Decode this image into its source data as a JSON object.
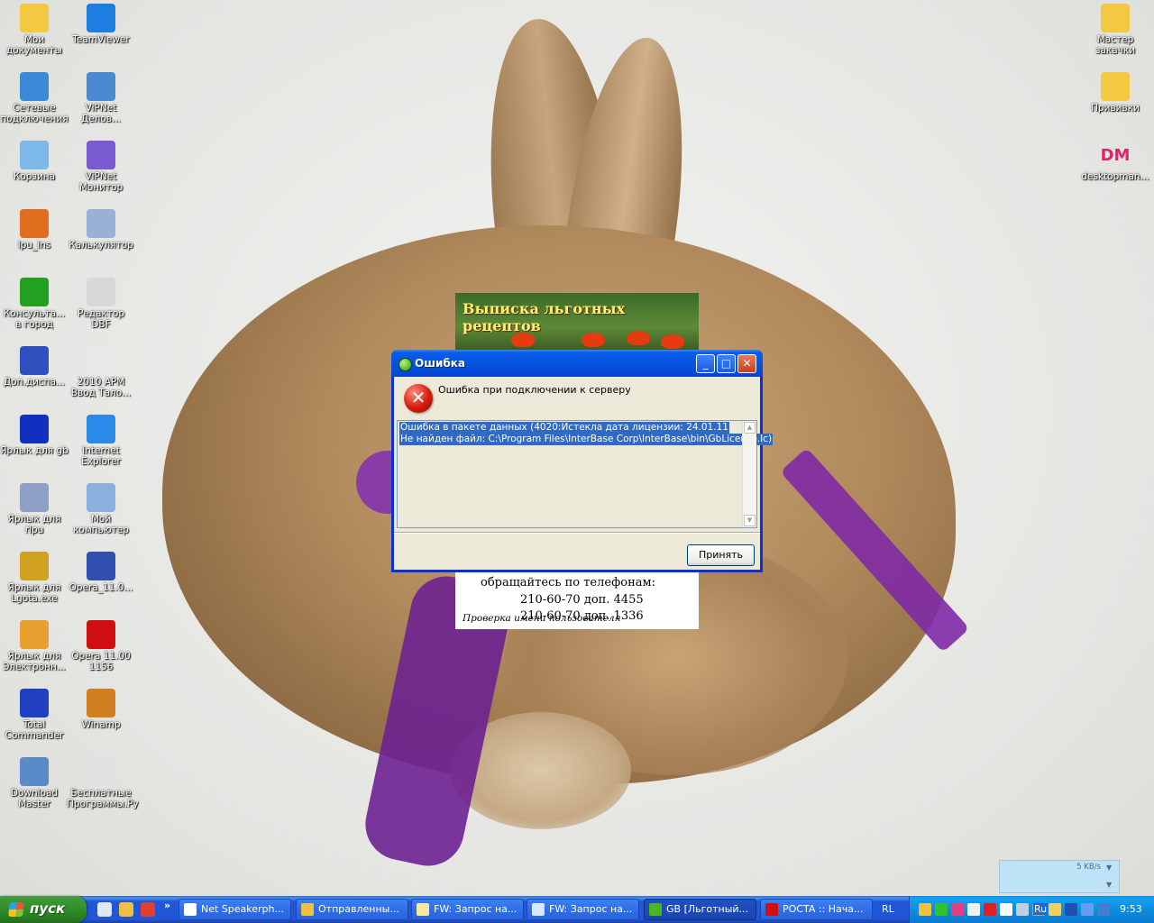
{
  "desktop": {
    "icons_left": [
      {
        "label": "Мои документы",
        "icon": "folder-icon",
        "color": "#f3c944"
      },
      {
        "label": "TeamViewer",
        "icon": "teamviewer-icon",
        "color": "#1c7ee0"
      },
      {
        "label": "Сетевые подключения",
        "icon": "network-icon",
        "color": "#3a8ad8"
      },
      {
        "label": "ViPNet Делов...",
        "icon": "vipnet-icon",
        "color": "#4a88d0"
      },
      {
        "label": "Корзина",
        "icon": "recycle-bin-icon",
        "color": "#7cb8e8"
      },
      {
        "label": "ViPNet Монитор",
        "icon": "vipnet-monitor-icon",
        "color": "#7a5ad0"
      },
      {
        "label": "lpu_ins",
        "icon": "fox-icon",
        "color": "#e07020"
      },
      {
        "label": "Калькулятор",
        "icon": "calculator-icon",
        "color": "#9ab0d8"
      },
      {
        "label": "Консульта... в город",
        "icon": "play-icon",
        "color": "#22a022"
      },
      {
        "label": "Редактор DBF",
        "icon": "dbf-icon",
        "color": "#d8d8d8"
      },
      {
        "label": "Доп.диспа...",
        "icon": "flask-icon",
        "color": "#3050c0"
      },
      {
        "label": "2010 АРМ Ввод Тало...",
        "icon": "document-icon",
        "color": "#e8e8e8"
      },
      {
        "label": "Ярлык для gb",
        "icon": "sphere-icon",
        "color": "#1030c0"
      },
      {
        "label": "Internet Explorer",
        "icon": "ie-icon",
        "color": "#2a8ae8"
      },
      {
        "label": "Ярлык для rlpu",
        "icon": "computer-icon",
        "color": "#8ea0c8"
      },
      {
        "label": "Мой компьютер",
        "icon": "my-computer-icon",
        "color": "#8ab0e0"
      },
      {
        "label": "Ярлык для Lgota.exe",
        "icon": "lgota-icon",
        "color": "#d0a020"
      },
      {
        "label": "Opera_11.0...",
        "icon": "satellite-icon",
        "color": "#3050b0"
      },
      {
        "label": "Ярлык для Электронн...",
        "icon": "outlook-icon",
        "color": "#e8a030"
      },
      {
        "label": "Opera 11.00 1156",
        "icon": "opera-icon",
        "color": "#d01010"
      },
      {
        "label": "Total Commander",
        "icon": "floppy-icon",
        "color": "#2040c0"
      },
      {
        "label": "Winamp",
        "icon": "winamp-icon",
        "color": "#d08020"
      },
      {
        "label": "Download Master",
        "icon": "download-master-icon",
        "color": "#5a8ac8"
      },
      {
        "label": "Бесплатные Программы.Ру",
        "icon": "free-programs-icon",
        "color": "#e0e0e0"
      }
    ],
    "icons_right": [
      {
        "label": "Мастер закачки",
        "icon": "folder-icon",
        "color": "#f3c944"
      },
      {
        "label": "Прививки",
        "icon": "folder-icon",
        "color": "#f3c944"
      },
      {
        "label": "desktopman...",
        "icon": "dm-icon",
        "color": "#e8206a",
        "glyph": "DM"
      }
    ]
  },
  "banner": {
    "title": "Выписка льготных рецептов",
    "contact_text": "обращайтесь по телефонам:",
    "phone1": "210-60-70 доп. 4455",
    "phone2": "210-60-70 доп. 1336",
    "status": "Проверка имени пользователя"
  },
  "dialog": {
    "title": "Ошибка",
    "message": "Ошибка при подключении к серверу",
    "details": [
      "Ошибка в пакете данных (4020:Истекла дата лицензии: 24.01.11",
      "Не найден файл: C:\\Program Files\\InterBase Corp\\InterBase\\bin\\GbLicense.lc)"
    ],
    "ok_label": "Принять"
  },
  "netmon": {
    "rate": "5 KB/s"
  },
  "taskbar": {
    "start_label": "пуск",
    "quicklaunch": [
      {
        "icon": "show-desktop-icon",
        "color": "#e0e8f8"
      },
      {
        "icon": "outlook-express-icon",
        "color": "#f0c040"
      },
      {
        "icon": "chrome-icon",
        "color": "#e04030"
      }
    ],
    "tasks": [
      {
        "label": "Net Speakerph...",
        "icon": "speakerphone-icon",
        "color": "#ffffff",
        "active": false
      },
      {
        "label": "Отправленны...",
        "icon": "outlook-express-icon",
        "color": "#f0c040",
        "active": false
      },
      {
        "label": "FW: Запрос на...",
        "icon": "mail-icon",
        "color": "#f8e8a0",
        "active": false
      },
      {
        "label": "FW: Запрос на...",
        "icon": "mail-reply-icon",
        "color": "#d8e8ff",
        "active": false
      },
      {
        "label": "GB [Льготный...",
        "icon": "gb-app-icon",
        "color": "#48b820",
        "active": true
      },
      {
        "label": "POCTA :: Нача...",
        "icon": "opera-icon",
        "color": "#d01010",
        "active": false
      }
    ],
    "language": "RL",
    "tray": [
      {
        "icon": "tray-outlook-icon",
        "color": "#f0c040"
      },
      {
        "icon": "tray-green-icon",
        "color": "#30c030"
      },
      {
        "icon": "tray-grid-icon",
        "color": "#e04080"
      },
      {
        "icon": "tray-network-icon",
        "color": "#f0f0f0"
      },
      {
        "icon": "tray-kaspersky-icon",
        "color": "#e02020"
      },
      {
        "icon": "tray-vipnet-icon",
        "color": "#ffffff"
      },
      {
        "icon": "tray-lang-icon",
        "color": "#c0d0e0"
      },
      {
        "icon": "tray-volume-icon",
        "color": "#e0a020"
      },
      {
        "icon": "tray-pen-icon",
        "color": "#f0d060"
      },
      {
        "icon": "tray-monitor-icon",
        "color": "#2050b0"
      },
      {
        "icon": "tray-network-traffic-icon",
        "color": "#60a0f0"
      },
      {
        "icon": "tray-globe-icon",
        "color": "#4080d0"
      }
    ],
    "tray_ru": "Ru",
    "clock": "9:53"
  }
}
